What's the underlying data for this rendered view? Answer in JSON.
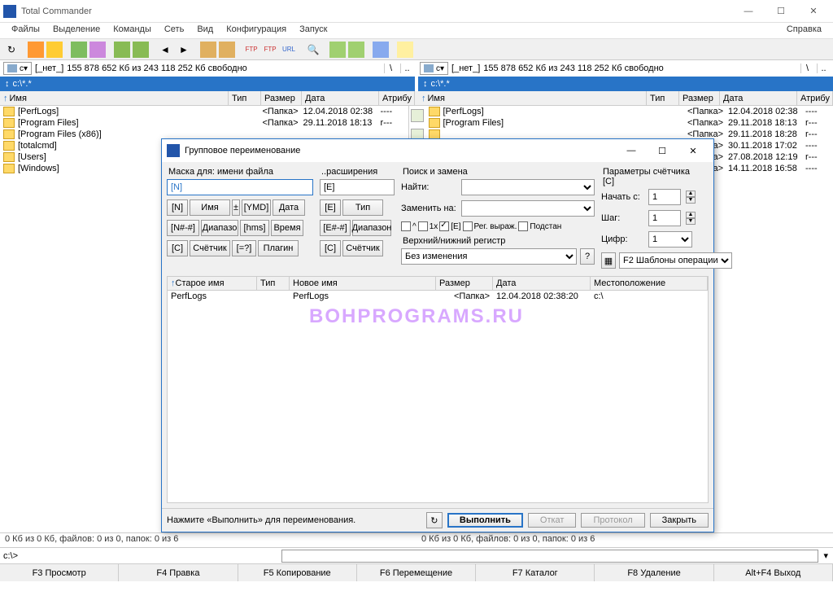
{
  "title": "Total Commander",
  "menu": [
    "Файлы",
    "Выделение",
    "Команды",
    "Сеть",
    "Вид",
    "Конфигурация",
    "Запуск"
  ],
  "menu_right": "Справка",
  "drive": {
    "letter": "c",
    "label": "[_нет_]",
    "free": "155 878 652 Кб из 243 118 252 Кб свободно"
  },
  "path": "c:\\*.*",
  "cols": {
    "name": "Имя",
    "type": "Тип",
    "size": "Размер",
    "date": "Дата",
    "attr": "Атрибу"
  },
  "left_files": [
    {
      "name": "[PerfLogs]",
      "size": "<Папка>",
      "date": "12.04.2018 02:38",
      "attr": "----"
    },
    {
      "name": "[Program Files]",
      "size": "<Папка>",
      "date": "29.11.2018 18:13",
      "attr": "r---"
    },
    {
      "name": "[Program Files (x86)]",
      "size": "",
      "date": "",
      "attr": ""
    },
    {
      "name": "[totalcmd]",
      "size": "",
      "date": "",
      "attr": ""
    },
    {
      "name": "[Users]",
      "size": "",
      "date": "",
      "attr": ""
    },
    {
      "name": "[Windows]",
      "size": "",
      "date": "",
      "attr": ""
    }
  ],
  "right_files": [
    {
      "name": "[PerfLogs]",
      "size": "<Папка>",
      "date": "12.04.2018 02:38",
      "attr": "----"
    },
    {
      "name": "[Program Files]",
      "size": "<Папка>",
      "date": "29.11.2018 18:13",
      "attr": "r---"
    },
    {
      "name": "",
      "size": "<Папка>",
      "date": "29.11.2018 18:28",
      "attr": "r---"
    },
    {
      "name": "",
      "size": "<Папка>",
      "date": "30.11.2018 17:02",
      "attr": "----"
    },
    {
      "name": "",
      "size": "<Папка>",
      "date": "27.08.2018 12:19",
      "attr": "r---"
    },
    {
      "name": "",
      "size": "<Папка>",
      "date": "14.11.2018 16:58",
      "attr": "----"
    }
  ],
  "status": "0 Кб из 0 Кб, файлов: 0 из 0, папок: 0 из 6",
  "cmdprompt": "c:\\>",
  "fn": [
    "F3 Просмотр",
    "F4 Правка",
    "F5 Копирование",
    "F6 Перемещение",
    "F7 Каталог",
    "F8 Удаление",
    "Alt+F4 Выход"
  ],
  "dlg": {
    "title": "Групповое переименование",
    "mask_name_lbl": "Маска для: имени файла",
    "mask_name_val": "[N]",
    "mask_ext_lbl": "..расширения",
    "mask_ext_val": "[E]",
    "search_lbl": "Поиск и замена",
    "find_lbl": "Найти:",
    "replace_lbl": "Заменить на:",
    "case_lbl": "Верхний/нижний регистр",
    "case_val": "Без изменения",
    "counter_lbl": "Параметры счётчика [C]",
    "start_lbl": "Начать с:",
    "start_val": "1",
    "step_lbl": "Шаг:",
    "step_val": "1",
    "digits_lbl": "Цифр:",
    "digits_val": "1",
    "btn_N": "[N]",
    "btn_name": "Имя",
    "btn_YMD": "[YMD]",
    "btn_date": "Дата",
    "btn_Nrange": "[N#-#]",
    "btn_range": "Диапазо",
    "btn_hms": "[hms]",
    "btn_time": "Время",
    "btn_C": "[C]",
    "btn_counter": "Счётчик",
    "btn_eq": "[=?]",
    "btn_plugin": "Плагин",
    "btn_E": "[E]",
    "btn_type": "Тип",
    "btn_Erange": "[E#-#]",
    "btn_range2": "Диапазон",
    "btn_C2": "[C]",
    "btn_counter2": "Счётчик",
    "chk_1x": "1x",
    "chk_E": "[E]",
    "chk_regex": "Рег. выраж.",
    "chk_subst": "Подстан",
    "template_lbl": "F2 Шаблоны операции",
    "listcols": {
      "old": "Старое имя",
      "type": "Тип",
      "new": "Новое имя",
      "size": "Размер",
      "date": "Дата",
      "loc": "Местоположение"
    },
    "listrow": {
      "old": "PerfLogs",
      "new": "PerfLogs",
      "size": "<Папка>",
      "date": "12.04.2018 02:38:20",
      "loc": "c:\\"
    },
    "hint": "Нажмите «Выполнить» для переименования.",
    "execute": "Выполнить",
    "undo": "Откат",
    "protocol": "Протокол",
    "close": "Закрыть"
  },
  "watermark": "BOHPROGRAMS.RU"
}
